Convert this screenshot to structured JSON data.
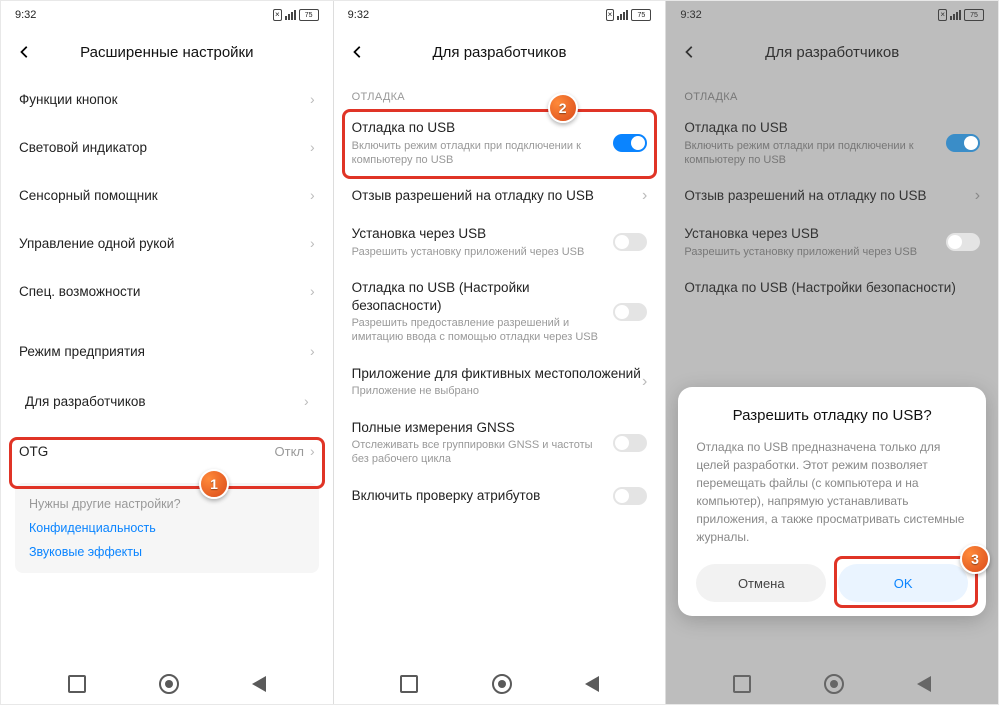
{
  "status": {
    "time": "9:32",
    "battery": "75"
  },
  "p1": {
    "title": "Расширенные настройки",
    "rows": [
      "Функции кнопок",
      "Световой индикатор",
      "Сенсорный помощник",
      "Управление одной рукой",
      "Спец. возможности"
    ],
    "row_enterprise": "Режим предприятия",
    "row_dev": "Для разработчиков",
    "row_otg": "OTG",
    "row_otg_val": "Откл",
    "card_q": "Нужны другие настройки?",
    "card_l1": "Конфиденциальность",
    "card_l2": "Звуковые эффекты"
  },
  "p2": {
    "title": "Для разработчиков",
    "group": "ОТЛАДКА",
    "r1_t": "Отладка по USB",
    "r1_s": "Включить режим отладки при подключении к компьютеру по USB",
    "r2_t": "Отзыв разрешений на отладку по USB",
    "r3_t": "Установка через USB",
    "r3_s": "Разрешить установку приложений через USB",
    "r4_t": "Отладка по USB (Настройки безопасности)",
    "r4_s": "Разрешить предоставление разрешений и имитацию ввода с помощью отладки через USB",
    "r5_t": "Приложение для фиктивных местоположений",
    "r5_s": "Приложение не выбрано",
    "r6_t": "Полные измерения GNSS",
    "r6_s": "Отслеживать все группировки GNSS и частоты без рабочего цикла",
    "r7_t": "Включить проверку атрибутов"
  },
  "modal": {
    "title": "Разрешить отладку по USB?",
    "body": "Отладка по USB предназначена только для целей разработки. Этот режим позволяет перемещать файлы (с компьютера и на компьютер), напрямую устанавливать приложения, а также просматривать системные журналы.",
    "cancel": "Отмена",
    "ok": "OK"
  },
  "badges": {
    "b1": "1",
    "b2": "2",
    "b3": "3"
  }
}
